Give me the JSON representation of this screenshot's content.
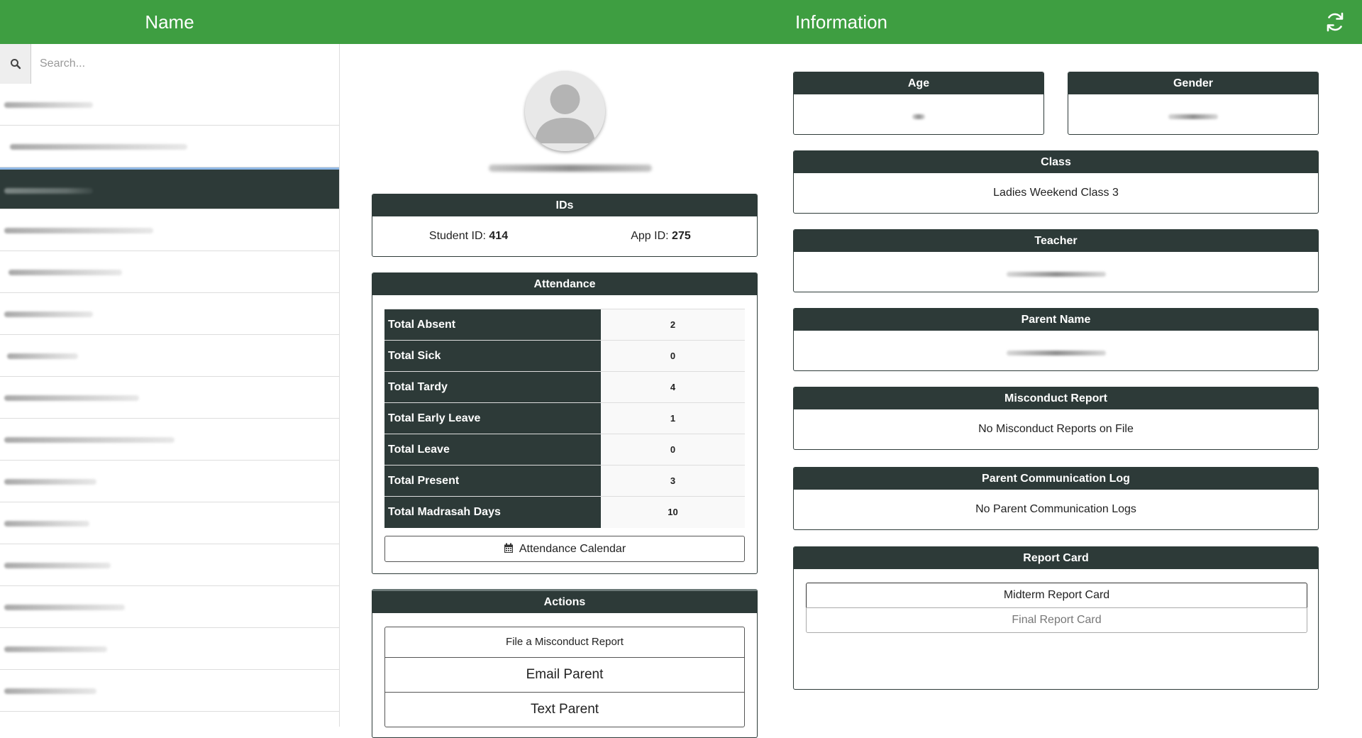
{
  "header": {
    "left_title": "Name",
    "center_title": "Information",
    "refresh_icon": "refresh-icon"
  },
  "sidebar": {
    "search": {
      "placeholder": "Search...",
      "value": "",
      "icon": "search-icon"
    },
    "selected_index": 2,
    "item_count": 15
  },
  "profile": {
    "avatar_icon": "user-avatar-icon"
  },
  "ids": {
    "title": "IDs",
    "student_label": "Student ID: ",
    "student_value": "414",
    "app_label": "App ID: ",
    "app_value": "275"
  },
  "attendance": {
    "title": "Attendance",
    "rows": [
      {
        "label": "Total Absent",
        "value": "2"
      },
      {
        "label": "Total Sick",
        "value": "0"
      },
      {
        "label": "Total Tardy",
        "value": "4"
      },
      {
        "label": "Total Early Leave",
        "value": "1"
      },
      {
        "label": "Total Leave",
        "value": "0"
      },
      {
        "label": "Total Present",
        "value": "3"
      },
      {
        "label": "Total Madrasah Days",
        "value": "10"
      }
    ],
    "calendar_button": "Attendance Calendar",
    "calendar_icon": "calendar-icon"
  },
  "actions": {
    "title": "Actions",
    "misconduct_button": "File a Misconduct Report",
    "email_button": "Email Parent",
    "text_button": "Text Parent"
  },
  "info": {
    "age_title": "Age",
    "gender_title": "Gender",
    "class_title": "Class",
    "class_value": "Ladies Weekend Class 3",
    "teacher_title": "Teacher",
    "parent_name_title": "Parent Name",
    "misconduct_title": "Misconduct Report",
    "misconduct_value": "No Misconduct Reports on File",
    "comm_title": "Parent Communication Log",
    "comm_value": "No Parent Communication Logs",
    "report_card_title": "Report Card",
    "midterm_button": "Midterm Report Card",
    "final_button": "Final Report Card"
  },
  "colors": {
    "header_green": "#3e9e41",
    "panel_dark": "#2d3a38",
    "selected_border": "#8fb8e6"
  }
}
